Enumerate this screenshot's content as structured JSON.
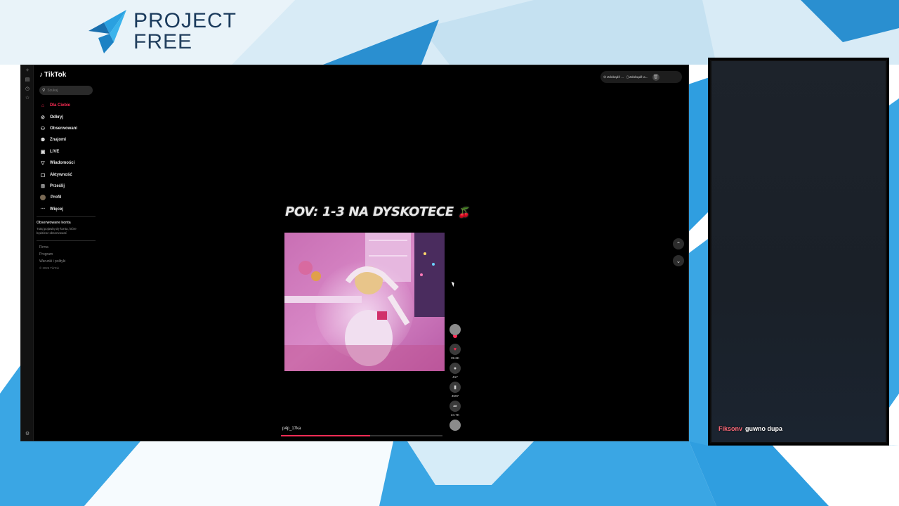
{
  "brand": {
    "line1": "PROJECT",
    "line2": "FREE"
  },
  "tiktok": {
    "logo_text": "TikTok",
    "search_placeholder": "Szukaj",
    "nav": [
      {
        "label": "Dla Ciebie",
        "icon": "home-icon",
        "active": true
      },
      {
        "label": "Odkryj",
        "icon": "compass-icon"
      },
      {
        "label": "Obserwowani",
        "icon": "user-follow-icon"
      },
      {
        "label": "Znajomi",
        "icon": "friends-icon"
      },
      {
        "label": "LIVE",
        "icon": "live-icon"
      },
      {
        "label": "Wiadomości",
        "icon": "send-icon"
      },
      {
        "label": "Aktywność",
        "icon": "message-icon"
      },
      {
        "label": "Prześlij",
        "icon": "upload-icon"
      },
      {
        "label": "Profil",
        "icon": "avatar-icon"
      },
      {
        "label": "Więcej",
        "icon": "more-icon"
      }
    ],
    "following_title": "Obserwowane konta",
    "following_desc": "Tutaj pojawią się konta, które będziesz obserwować",
    "footer": {
      "link1": "Firma",
      "link2": "Program",
      "link3": "Warunki i polityki",
      "copyright": "© 2025 TikTok"
    },
    "top_right": {
      "btn1": "Zdobądź ...",
      "btn2": "Zdobądź a..."
    },
    "video": {
      "caption_overlay": "POV: 1-3 NA DYSKOTECE",
      "creator": "p4p_17ka",
      "progress_fraction": 0.55
    },
    "actions": {
      "likes": "39.6K",
      "comments": "417",
      "saves": "4597",
      "shares": "24.7K"
    }
  },
  "chat": {
    "username": "Fiksonv",
    "message": "guwno dupa"
  },
  "colors": {
    "accent": "#fe2c55",
    "brand_blue": "#1a3a5c",
    "bg_blue": "#3aa6e4",
    "bg_light": "#cfe6f3"
  }
}
